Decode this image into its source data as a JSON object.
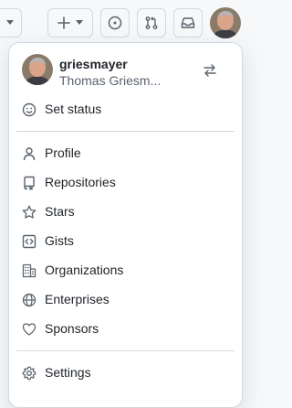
{
  "topbar": {
    "icons": [
      "triangle-down-icon",
      "plus-icon",
      "issue-opened-icon",
      "git-pull-request-icon",
      "inbox-icon"
    ]
  },
  "user": {
    "username": "griesmayer",
    "full_name": "Thomas Griesm..."
  },
  "menu": {
    "status_label": "Set status",
    "items": [
      {
        "label": "Profile",
        "icon": "person-icon"
      },
      {
        "label": "Repositories",
        "icon": "repo-icon"
      },
      {
        "label": "Stars",
        "icon": "star-icon"
      },
      {
        "label": "Gists",
        "icon": "code-square-icon"
      },
      {
        "label": "Organizations",
        "icon": "organization-icon"
      },
      {
        "label": "Enterprises",
        "icon": "globe-icon"
      },
      {
        "label": "Sponsors",
        "icon": "heart-icon"
      }
    ],
    "settings_label": "Settings"
  },
  "colors": {
    "text": "#1f2328",
    "muted": "#59636e",
    "border": "#d1d9e0",
    "bg": "#f6f8fa"
  }
}
